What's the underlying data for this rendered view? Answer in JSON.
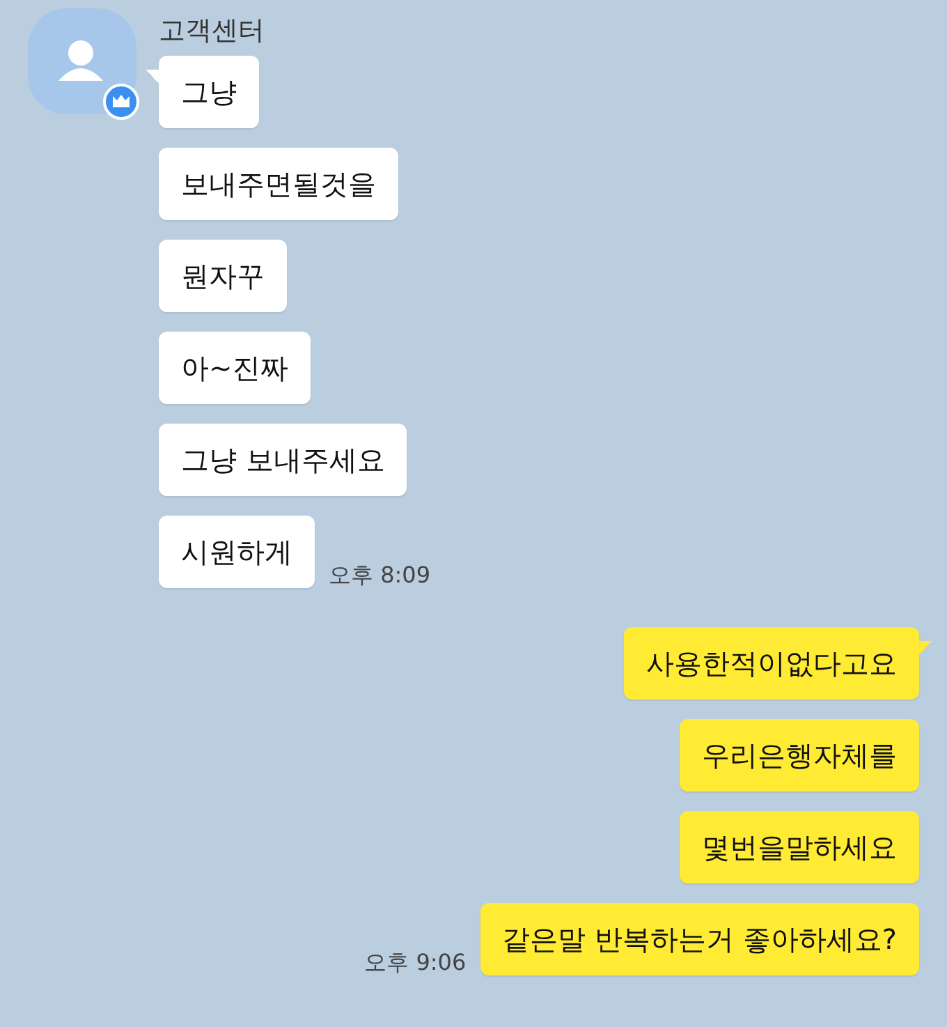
{
  "sender": {
    "name": "고객센터"
  },
  "groups": [
    {
      "kind": "received",
      "time": "오후 8:09",
      "messages": [
        {
          "text": "그냥",
          "tail": true
        },
        {
          "text": "보내주면될것을",
          "tail": false
        },
        {
          "text": "뭔자꾸",
          "tail": false
        },
        {
          "text": "아~진짜",
          "tail": false
        },
        {
          "text": "그냥 보내주세요",
          "tail": false
        },
        {
          "text": "시원하게",
          "tail": false
        }
      ]
    },
    {
      "kind": "sent",
      "time": "오후 9:06",
      "messages": [
        {
          "text": "사용한적이없다고요",
          "tail": true
        },
        {
          "text": "우리은행자체를",
          "tail": false
        },
        {
          "text": "몇번을말하세요",
          "tail": false
        },
        {
          "text": "같은말 반복하는거 좋아하세요?",
          "tail": false
        }
      ]
    }
  ]
}
